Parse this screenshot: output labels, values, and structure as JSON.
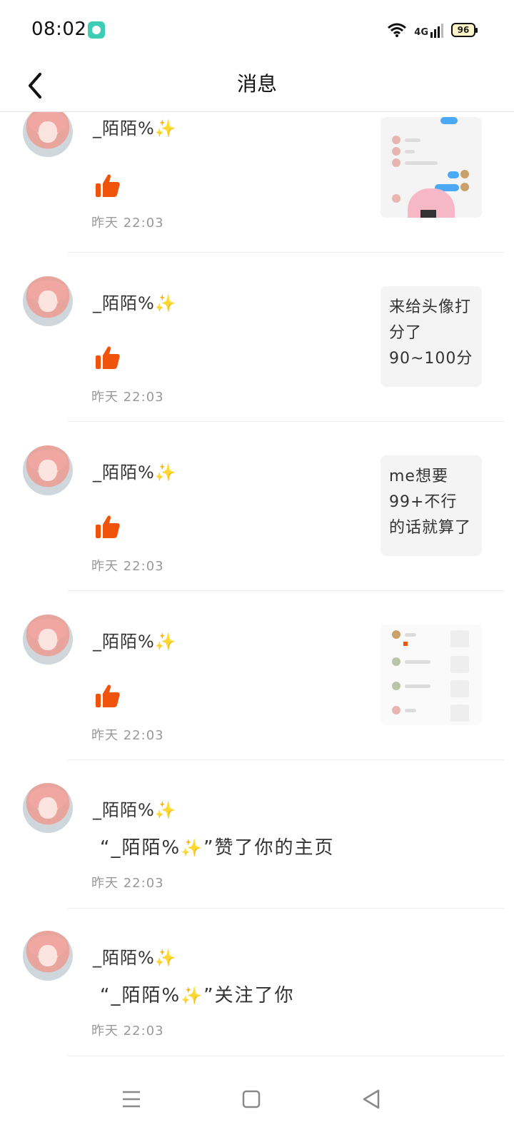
{
  "status_bar": {
    "time": "08:02",
    "network": "4G",
    "battery": "96"
  },
  "header": {
    "title": "消息"
  },
  "notifications": [
    {
      "user": "_陌陌%",
      "type": "like",
      "time": "昨天  22:03",
      "preview_kind": "screenshot"
    },
    {
      "user": "_陌陌%",
      "type": "like",
      "time": "昨天  22:03",
      "preview_kind": "text",
      "preview_text": "来给头像打分了90~100分 …"
    },
    {
      "user": "_陌陌%",
      "type": "like",
      "time": "昨天  22:03",
      "preview_kind": "text",
      "preview_text": "me想要99+不行的话就算了 …"
    },
    {
      "user": "_陌陌%",
      "type": "like",
      "time": "昨天  22:03",
      "preview_kind": "screenshot"
    },
    {
      "user": "_陌陌%",
      "type": "profile_like",
      "message_prefix": "“_陌陌%",
      "message_suffix": "”赞了你的主页",
      "time": "昨天  22:03"
    },
    {
      "user": "_陌陌%",
      "type": "follow",
      "message_prefix": "“_陌陌%",
      "message_suffix": "”关注了你",
      "time": "昨天  22:03"
    }
  ],
  "icons": {
    "sparkle": "✨",
    "like": "thumbs-up-icon",
    "back": "chevron-left-icon",
    "menu": "menu-icon",
    "home": "home-square-icon",
    "nav_back": "triangle-back-icon"
  },
  "colors": {
    "like": "#f0530c",
    "sparkle": "#f5c518",
    "time": "#999999"
  }
}
